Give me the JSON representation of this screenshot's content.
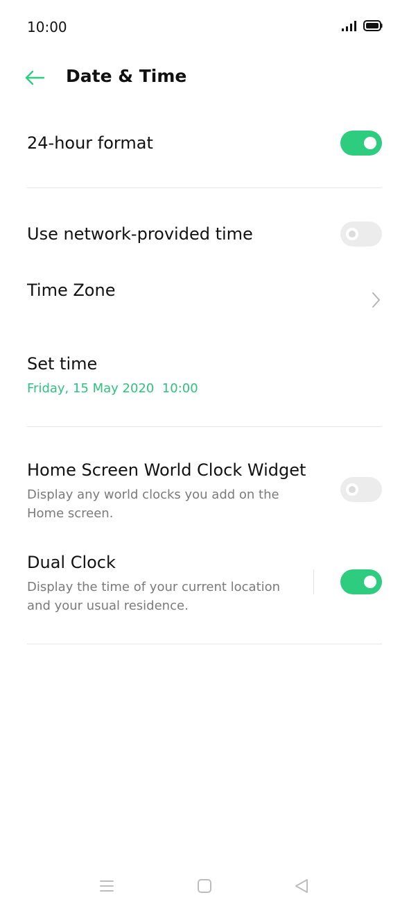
{
  "status_bar": {
    "time": "10:00"
  },
  "header": {
    "title": "Date & Time"
  },
  "settings": {
    "hour_format": {
      "label": "24-hour format",
      "enabled": true
    },
    "network_time": {
      "label": "Use network-provided time",
      "enabled": false
    },
    "time_zone": {
      "label": "Time Zone"
    },
    "set_time": {
      "label": "Set time",
      "value": "Friday, 15 May 2020  10:00"
    },
    "world_clock_widget": {
      "label": "Home Screen World Clock Widget",
      "description": "Display any world clocks you add on the Home screen.",
      "enabled": false
    },
    "dual_clock": {
      "label": "Dual Clock",
      "description": "Display the time of your current location and your usual residence.",
      "enabled": true
    }
  },
  "colors": {
    "accent": "#2ecc7f",
    "toggle_off": "#ececec",
    "secondary_text": "#7a7a7a"
  },
  "icons": {
    "back": "arrow-left-icon",
    "chevron": "chevron-right-icon",
    "signal": "signal-icon",
    "battery": "battery-icon",
    "nav_menu": "menu-icon",
    "nav_home": "home-icon",
    "nav_back": "back-triangle-icon"
  }
}
